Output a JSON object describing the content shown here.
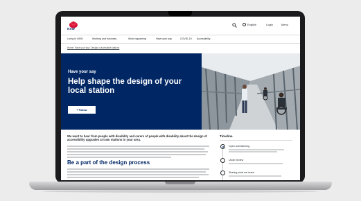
{
  "header": {
    "logo_text": "NSW",
    "language": "English",
    "login": "Login",
    "menu": "Menu"
  },
  "nav": {
    "items": [
      "Living in NSW",
      "Working and business",
      "Work happening",
      "Have your say",
      "COVID-19",
      "Accessibility"
    ]
  },
  "breadcrumb": {
    "text": "Home / Have your say / Design of accessible stations"
  },
  "hero": {
    "kicker": "Have your say",
    "title": "Help shape the design of your local station",
    "follow_label": "+ Follow"
  },
  "content": {
    "intro": "We want to hear from people with disability and carers of people with disability about the design of accessibility upgrades at train stations in your area.",
    "section_title": "Be a part of the design process"
  },
  "timeline": {
    "heading": "Timeline",
    "items": [
      {
        "label": "Open and listening",
        "state": "active"
      },
      {
        "label": "Under review",
        "state": "pending"
      },
      {
        "label": "Sharing what we heard",
        "state": "pending"
      }
    ]
  },
  "colors": {
    "brand_navy": "#002664",
    "brand_red": "#d7153a"
  }
}
